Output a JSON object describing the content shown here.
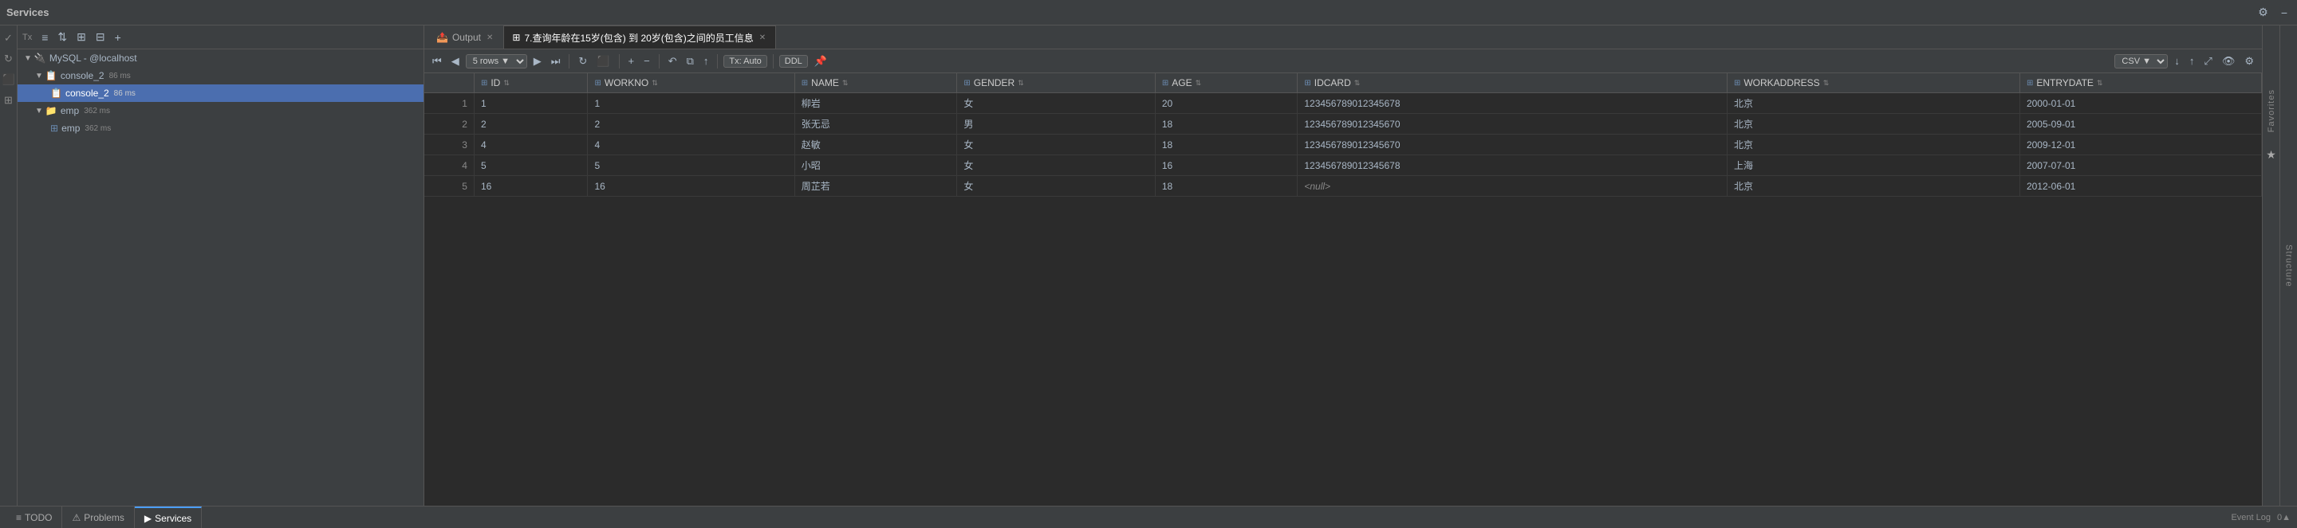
{
  "header": {
    "title": "Services",
    "settings_icon": "⚙",
    "minimize_icon": "−"
  },
  "sidebar": {
    "toolbar": {
      "tx_label": "Tx",
      "icons": [
        "≡",
        "⇅",
        "⊞",
        "⊟",
        "+"
      ]
    },
    "tree": [
      {
        "level": 2,
        "arrow": "▼",
        "icon": "🔌",
        "label": "MySQL - @localhost",
        "badge": "",
        "type": "connection"
      },
      {
        "level": 3,
        "arrow": "▼",
        "icon": "📋",
        "label": "console_2",
        "badge": "86 ms",
        "type": "console"
      },
      {
        "level": 4,
        "arrow": "",
        "icon": "📋",
        "label": "console_2",
        "badge": "86 ms",
        "type": "console-item",
        "selected": true
      },
      {
        "level": 3,
        "arrow": "▼",
        "icon": "📁",
        "label": "emp",
        "badge": "362 ms",
        "type": "group"
      },
      {
        "level": 4,
        "arrow": "",
        "icon": "⊞",
        "label": "emp",
        "badge": "362 ms",
        "type": "table"
      }
    ]
  },
  "tabs": [
    {
      "label": "Output",
      "icon": "📤",
      "active": false,
      "closable": true
    },
    {
      "label": "7.查询年龄在15岁(包含) 到 20岁(包含)之间的员工信息",
      "icon": "⊞",
      "active": true,
      "closable": true
    }
  ],
  "grid_toolbar": {
    "first_icon": "⏮",
    "prev_icon": "◀",
    "rows_label": "5 rows",
    "next_icon": "▶",
    "last_icon": "⏭",
    "refresh_icon": "↻",
    "stop_icon": "⬛",
    "add_icon": "+",
    "delete_icon": "−",
    "undo_icon": "↶",
    "copy_icon": "⧉",
    "upload_icon": "↑",
    "tx_label": "Tx: Auto",
    "ddl_label": "DDL",
    "pin_icon": "📌",
    "csv_label": "CSV",
    "download_icon": "↓",
    "upload2_icon": "↑",
    "resize_icon": "⤢",
    "eye_icon": "👁",
    "settings_icon": "⚙"
  },
  "columns": [
    {
      "icon": "⊞",
      "name": "ID",
      "sortable": true
    },
    {
      "icon": "⊞",
      "name": "WORKNO",
      "sortable": true
    },
    {
      "icon": "⊞",
      "name": "NAME",
      "sortable": true
    },
    {
      "icon": "⊞",
      "name": "GENDER",
      "sortable": true
    },
    {
      "icon": "⊞",
      "name": "AGE",
      "sortable": true
    },
    {
      "icon": "⊞",
      "name": "IDCARD",
      "sortable": true
    },
    {
      "icon": "⊞",
      "name": "WORKADDRESS",
      "sortable": true
    },
    {
      "icon": "⊞",
      "name": "ENTRYDATE",
      "sortable": true
    }
  ],
  "rows": [
    {
      "rownum": 1,
      "id": "1",
      "workno": "1",
      "name": "柳岩",
      "gender": "女",
      "age": "20",
      "idcard": "123456789012345678",
      "workaddress": "北京",
      "entrydate": "2000-01-01"
    },
    {
      "rownum": 2,
      "id": "2",
      "workno": "2",
      "name": "张无忌",
      "gender": "男",
      "age": "18",
      "idcard": "123456789012345670",
      "workaddress": "北京",
      "entrydate": "2005-09-01"
    },
    {
      "rownum": 3,
      "id": "4",
      "workno": "4",
      "name": "赵敏",
      "gender": "女",
      "age": "18",
      "idcard": "123456789012345670",
      "workaddress": "北京",
      "entrydate": "2009-12-01"
    },
    {
      "rownum": 4,
      "id": "5",
      "workno": "5",
      "name": "小昭",
      "gender": "女",
      "age": "16",
      "idcard": "123456789012345678",
      "workaddress": "上海",
      "entrydate": "2007-07-01"
    },
    {
      "rownum": 5,
      "id": "16",
      "workno": "16",
      "name": "周芷若",
      "gender": "女",
      "age": "18",
      "idcard": "<null>",
      "workaddress": "北京",
      "entrydate": "2012-06-01"
    }
  ],
  "bottom_bar": {
    "tabs": [
      {
        "icon": "≡",
        "label": "TODO"
      },
      {
        "icon": "⚠",
        "label": "Problems"
      },
      {
        "icon": "▶",
        "label": "Services",
        "active": true
      }
    ],
    "right": {
      "event_log": "Event Log",
      "notification": "0▲"
    }
  },
  "left_actions": [
    "✓",
    "↻",
    "⬛",
    "⊞"
  ],
  "favorites": {
    "label": "Favorites",
    "star": "★"
  },
  "structure": {
    "label": "Structure"
  }
}
